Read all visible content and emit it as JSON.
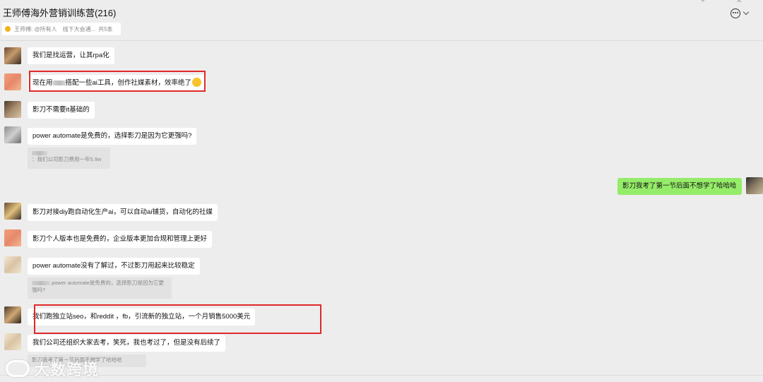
{
  "header": {
    "title": "王师傅海外营销训练营(216)",
    "pinned": {
      "text": "王师傅: @所有人　线下大会通...",
      "count": "共5条"
    }
  },
  "messages": [
    {
      "text": "我们是找运营，让其rpa化"
    },
    {
      "text_before": "现在用",
      "text_after": "搭配一些ai工具，创作社媒素材，效率绝了"
    },
    {
      "text": "影刀不需要it基础的"
    },
    {
      "text": "power automate是免费的，选择影刀是因为它更强吗?",
      "quote": "：我们公司影刀费用一年5.9w"
    },
    {
      "text": "影刀我考了第一节后面不想学了哈哈哈"
    },
    {
      "text": "影刀对接diy跑自动化生产ai，可以自动ai铺货，自动化的社媒"
    },
    {
      "text": "影刀个人版本也是免费的，企业版本更加合规和管理上更好"
    },
    {
      "text": "power automate没有了解过，不过影刀用起来比较稳定",
      "quote": "power automate是免费的，选择影刀是因为它更强吗?"
    },
    {
      "text": "我们跑独立站seo，和reddit ，fb，引流新的独立站，一个月销售5000美元"
    },
    {
      "text": "我们公司还组织大家去考，笑死，我也考过了，但是没有后续了",
      "quote": "影刀我考了第一节后面不想学了哈哈哈"
    }
  ],
  "watermark": "大数跨境",
  "colors": {
    "bubble_self": "#95ec69",
    "bubble_other": "#ffffff",
    "highlight_box": "#e02828",
    "background": "#ededed"
  }
}
